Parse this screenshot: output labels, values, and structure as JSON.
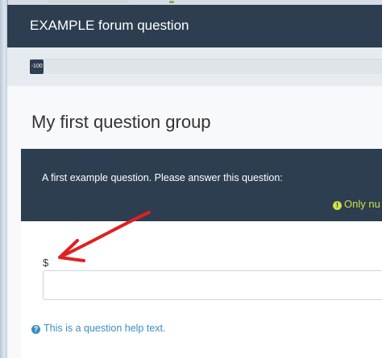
{
  "header": {
    "title": "EXAMPLE forum question"
  },
  "progress": {
    "label": "-100",
    "value": 0.04
  },
  "group": {
    "title": "My first question group"
  },
  "question": {
    "text": "A first example question. Please answer this question:",
    "warning_icon": "exclamation-circle-icon",
    "warning": "Only nu"
  },
  "answer": {
    "prefix": "$",
    "value": ""
  },
  "help": {
    "icon": "question-circle-icon",
    "text": "This is a question help text."
  },
  "colors": {
    "header_bg": "#2c3e50",
    "warning": "#d0e342",
    "help": "#3b8ec2",
    "annotation_arrow": "#e02020"
  }
}
